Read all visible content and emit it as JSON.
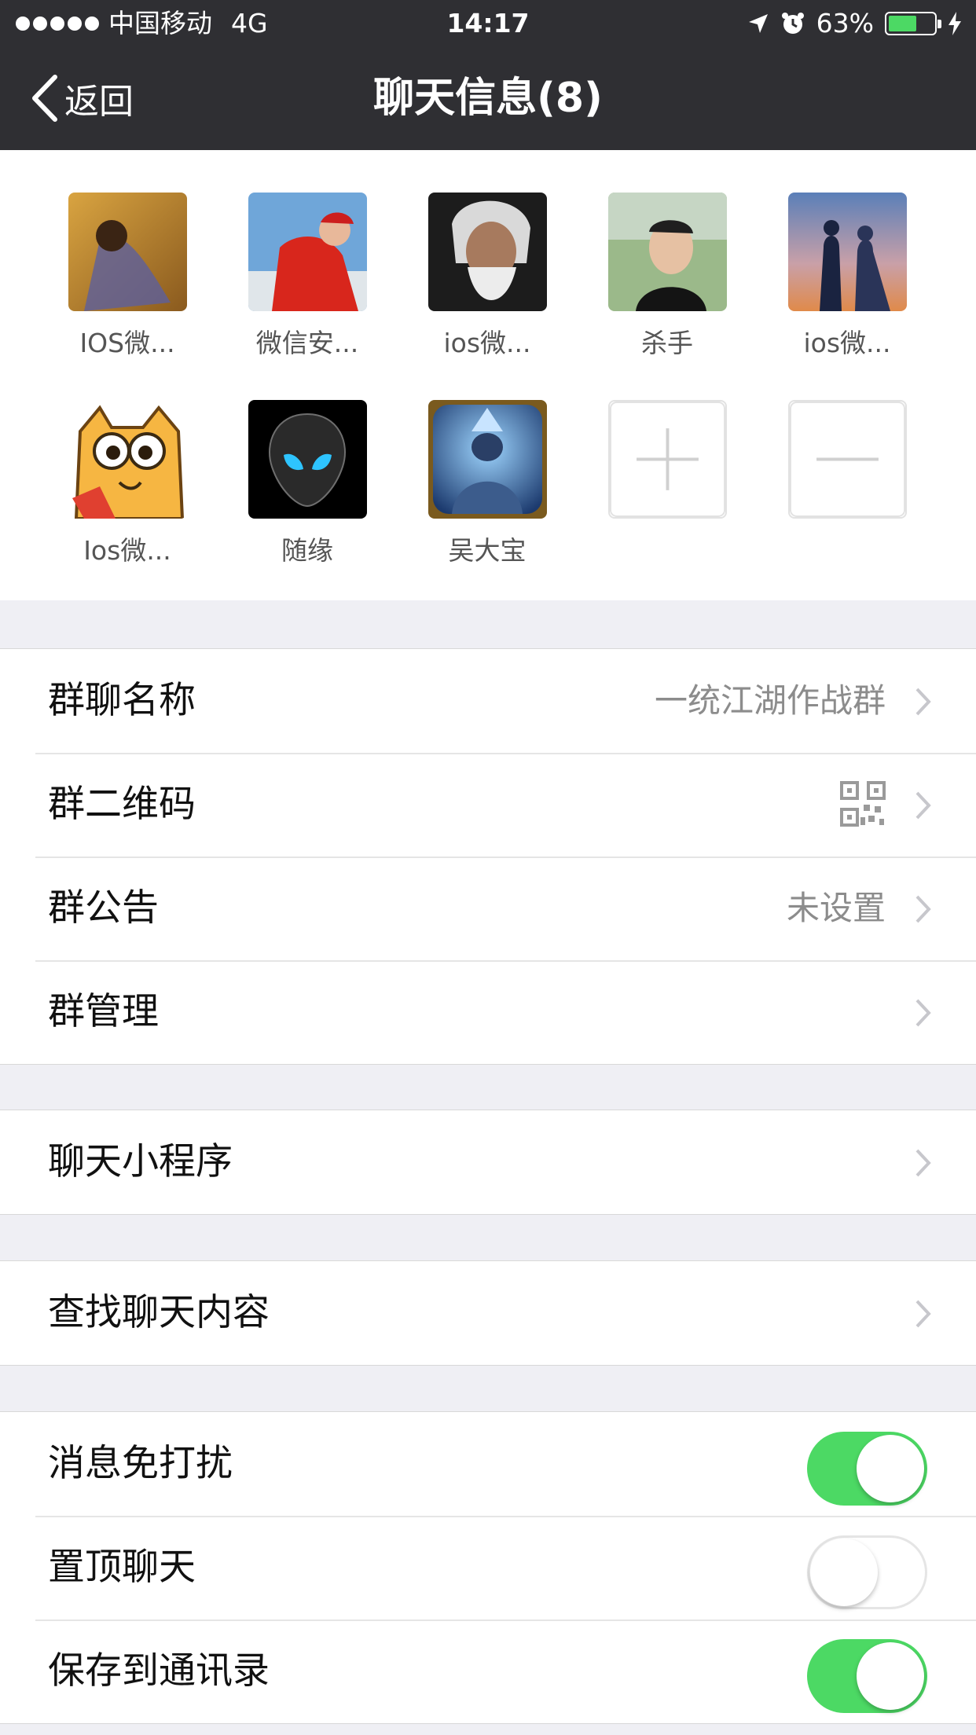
{
  "status_bar": {
    "carrier": "中国移动",
    "network": "4G",
    "time": "14:17",
    "battery": "63%",
    "battery_level": 0.63,
    "accent_color": "#4cd964"
  },
  "nav": {
    "back_label": "返回",
    "title": "聊天信息(8)"
  },
  "members": [
    {
      "name": "IOS微...",
      "avatar": "woman-autumn-photo"
    },
    {
      "name": "微信安...",
      "avatar": "man-red-cap-photo"
    },
    {
      "name": "ios微...",
      "avatar": "old-man-white-beard-photo"
    },
    {
      "name": "杀手",
      "avatar": "young-man-photo"
    },
    {
      "name": "ios微...",
      "avatar": "couple-silhouette-photo"
    },
    {
      "name": "Ios微...",
      "avatar": "cartoon-cat"
    },
    {
      "name": "随缘",
      "avatar": "alien-head"
    },
    {
      "name": "吴大宝",
      "avatar": "game-character-portrait"
    }
  ],
  "group_settings": {
    "name_label": "群聊名称",
    "name_value": "一统江湖作战群",
    "qrcode_label": "群二维码",
    "notice_label": "群公告",
    "notice_value": "未设置",
    "manage_label": "群管理"
  },
  "mini_programs": {
    "label": "聊天小程序"
  },
  "search": {
    "label": "查找聊天内容"
  },
  "toggles": [
    {
      "label": "消息免打扰",
      "on": true
    },
    {
      "label": "置顶聊天",
      "on": false
    },
    {
      "label": "保存到通讯录",
      "on": true
    }
  ]
}
